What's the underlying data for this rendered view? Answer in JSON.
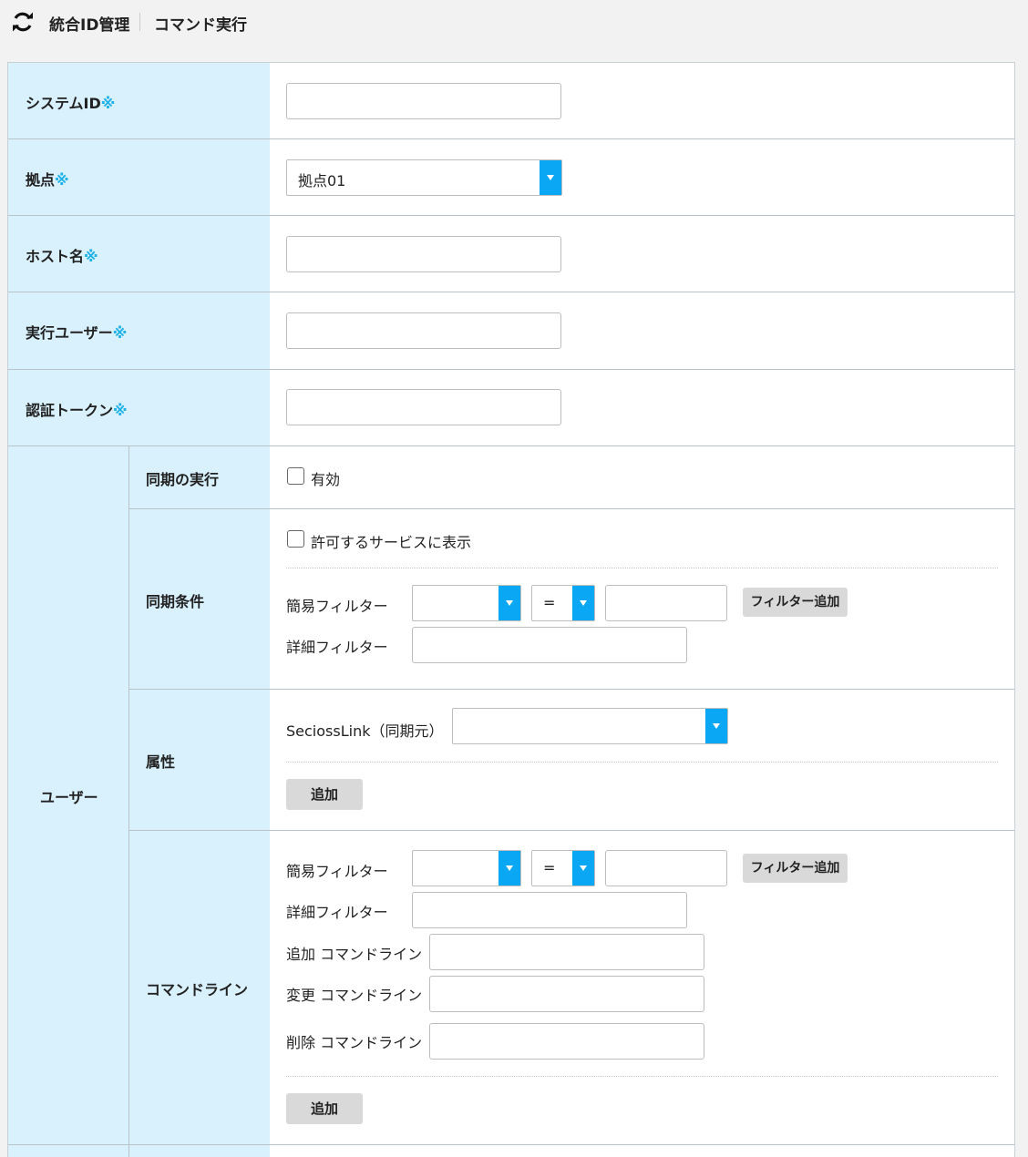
{
  "header": {
    "app_name": "統合ID管理",
    "page_title": "コマンド実行"
  },
  "required_mark": "※",
  "fields": {
    "system_id": {
      "label": "システムID",
      "value": ""
    },
    "site": {
      "label": "拠点",
      "selected": "拠点01"
    },
    "host_name": {
      "label": "ホスト名",
      "value": ""
    },
    "exec_user": {
      "label": "実行ユーザー",
      "value": ""
    },
    "auth_token": {
      "label": "認証トークン",
      "value": ""
    }
  },
  "user_section": {
    "label": "ユーザー",
    "sync_exec": {
      "label": "同期の実行",
      "checkbox_label": "有効"
    },
    "sync_condition": {
      "label": "同期条件",
      "show_allowed_label": "許可するサービスに表示",
      "simple_filter_label": "簡易フィルター",
      "operator": "=",
      "add_filter_button": "フィルター追加",
      "detail_filter_label": "詳細フィルター"
    },
    "attributes": {
      "label": "属性",
      "source_label": "SeciossLink（同期元）",
      "add_button": "追加"
    },
    "command_line": {
      "label": "コマンドライン",
      "simple_filter_label": "簡易フィルター",
      "operator": "=",
      "add_filter_button": "フィルター追加",
      "detail_filter_label": "詳細フィルター",
      "add_cmd_label": "追加 コマンドライン",
      "modify_cmd_label": "変更 コマンドライン",
      "delete_cmd_label": "削除 コマンドライン",
      "add_button": "追加"
    }
  }
}
